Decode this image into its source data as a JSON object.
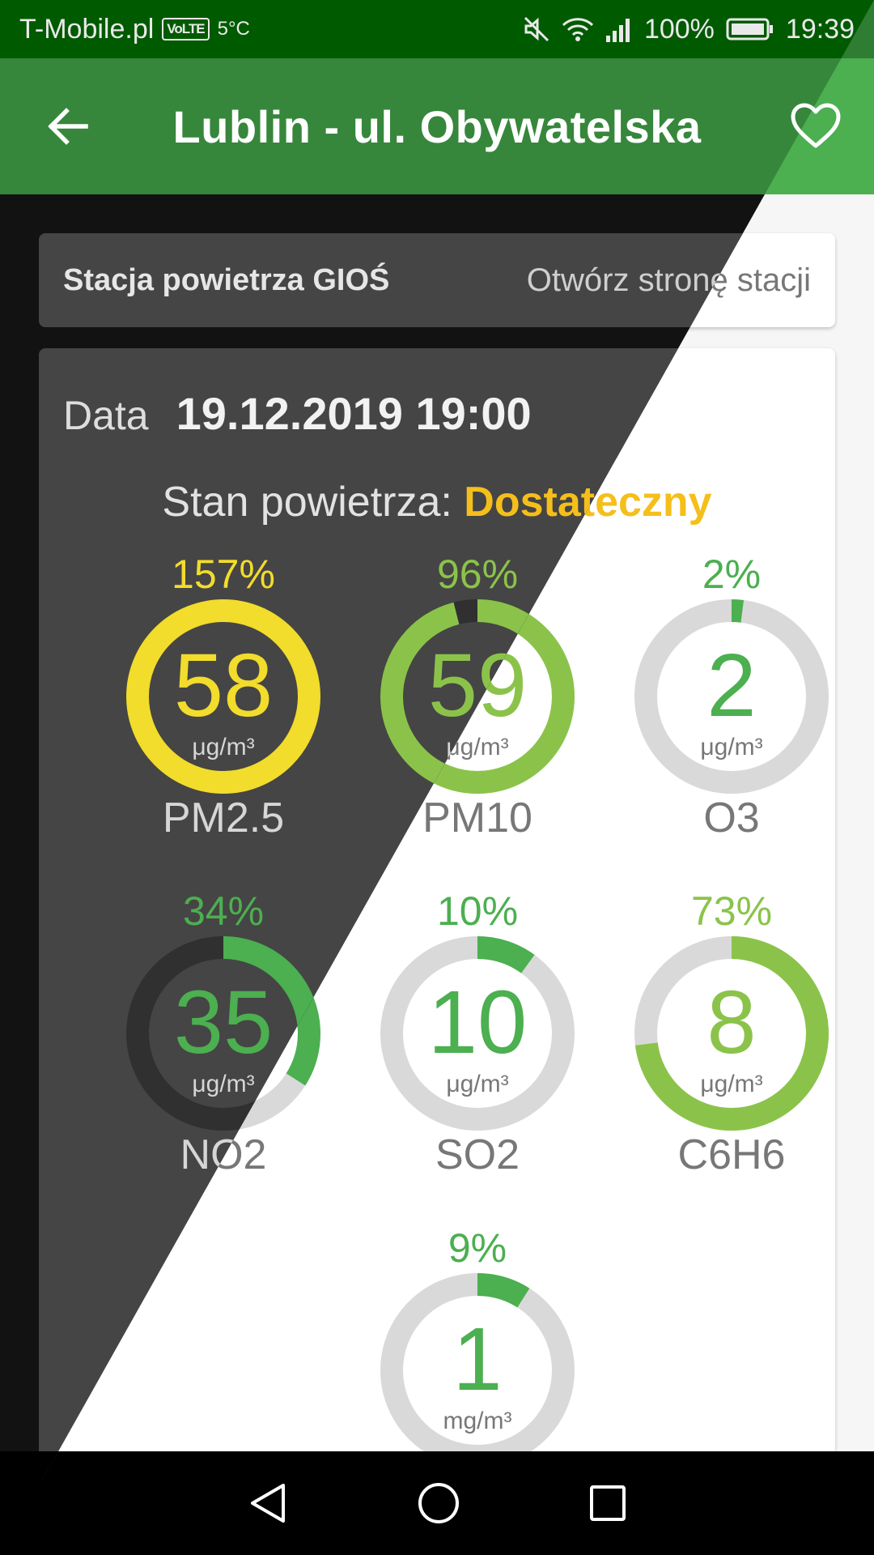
{
  "status_bar": {
    "carrier": "T-Mobile.pl",
    "network_badge": "VoLTE",
    "temperature": "5°C",
    "battery": "100%",
    "time": "19:39",
    "icons": [
      "mute-icon",
      "wifi-icon",
      "signal-icon",
      "battery-icon"
    ]
  },
  "app_bar": {
    "title": "Lublin - ul. Obywatelska",
    "back_icon": "arrow-left-icon",
    "favorite_icon": "heart-outline-icon"
  },
  "station": {
    "label": "Stacja powietrza GIOŚ",
    "link": "Otwórz stronę stacji"
  },
  "measurement": {
    "date_label": "Data",
    "date_value": "19.12.2019 19:00",
    "state_label": "Stan powietrza:",
    "state_value": "Dostateczny",
    "state_color": "#f5bf1b"
  },
  "pollutants": [
    {
      "name": "PM2.5",
      "value": "58",
      "unit": "μg/m³",
      "percent_label": "157%",
      "fill": 1.0,
      "color": "#f2dc2c"
    },
    {
      "name": "PM10",
      "value": "59",
      "unit": "μg/m³",
      "percent_label": "96%",
      "fill": 0.96,
      "color": "#8bc34a"
    },
    {
      "name": "O3",
      "value": "2",
      "unit": "μg/m³",
      "percent_label": "2%",
      "fill": 0.02,
      "color": "#4caf50"
    },
    {
      "name": "NO2",
      "value": "35",
      "unit": "μg/m³",
      "percent_label": "34%",
      "fill": 0.34,
      "color": "#4caf50"
    },
    {
      "name": "SO2",
      "value": "10",
      "unit": "μg/m³",
      "percent_label": "10%",
      "fill": 0.1,
      "color": "#4caf50"
    },
    {
      "name": "C6H6",
      "value": "8",
      "unit": "μg/m³",
      "percent_label": "73%",
      "fill": 0.73,
      "color": "#8bc34a"
    },
    {
      "name": "",
      "value": "1",
      "unit": "mg/m³",
      "percent_label": "9%",
      "fill": 0.09,
      "color": "#4caf50"
    }
  ],
  "nav_bar": {
    "back": "nav-back-icon",
    "home": "nav-home-icon",
    "recents": "nav-recents-icon"
  }
}
